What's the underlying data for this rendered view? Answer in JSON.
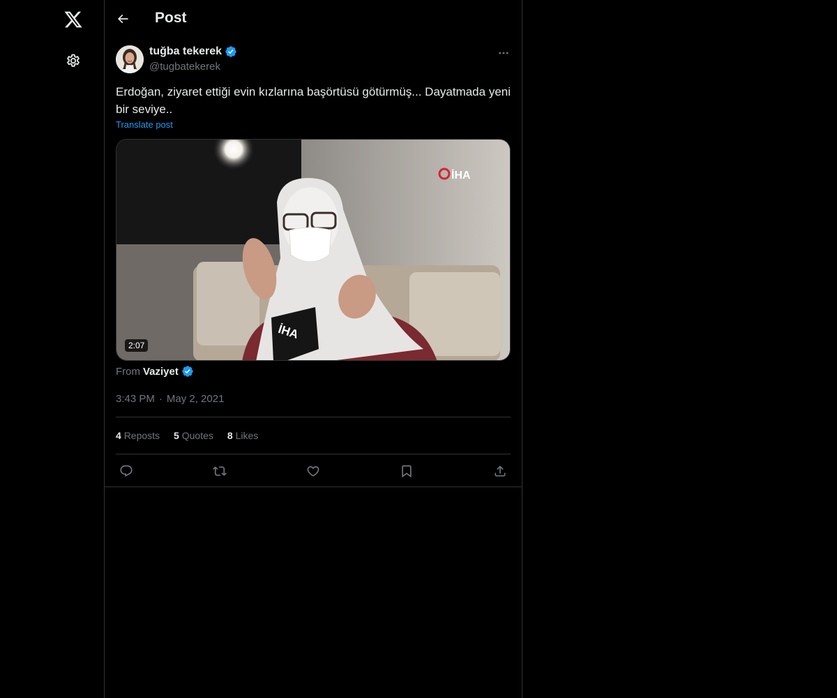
{
  "header": {
    "title": "Post"
  },
  "author": {
    "name": "tuğba tekerek",
    "handle": "@tugbatekerek"
  },
  "post": {
    "text": "Erdoğan, ziyaret ettiği evin kızlarına başörtüsü götürmüş... Dayatmada yeni bir seviye..",
    "translate_label": "Translate post",
    "video_duration": "2:07",
    "video_watermark": "İHA",
    "from_label": "From",
    "from_source": "Vaziyet",
    "time": "3:43 PM",
    "separator": "·",
    "date": "May 2, 2021"
  },
  "stats": {
    "reposts_count": "4",
    "reposts_label": "Reposts",
    "quotes_count": "5",
    "quotes_label": "Quotes",
    "likes_count": "8",
    "likes_label": "Likes"
  },
  "icons": {
    "logo": "x-logo-icon",
    "settings": "gear-icon",
    "back": "arrow-left-icon",
    "verified": "verified-badge-icon",
    "more": "more-horizontal-icon",
    "reply": "reply-icon",
    "repost": "repost-icon",
    "like": "heart-icon",
    "bookmark": "bookmark-icon",
    "share": "share-icon"
  },
  "colors": {
    "accent": "#1d9bf0",
    "text": "#e7e9ea",
    "muted": "#71767b",
    "border": "#2f3336",
    "background": "#000000"
  }
}
